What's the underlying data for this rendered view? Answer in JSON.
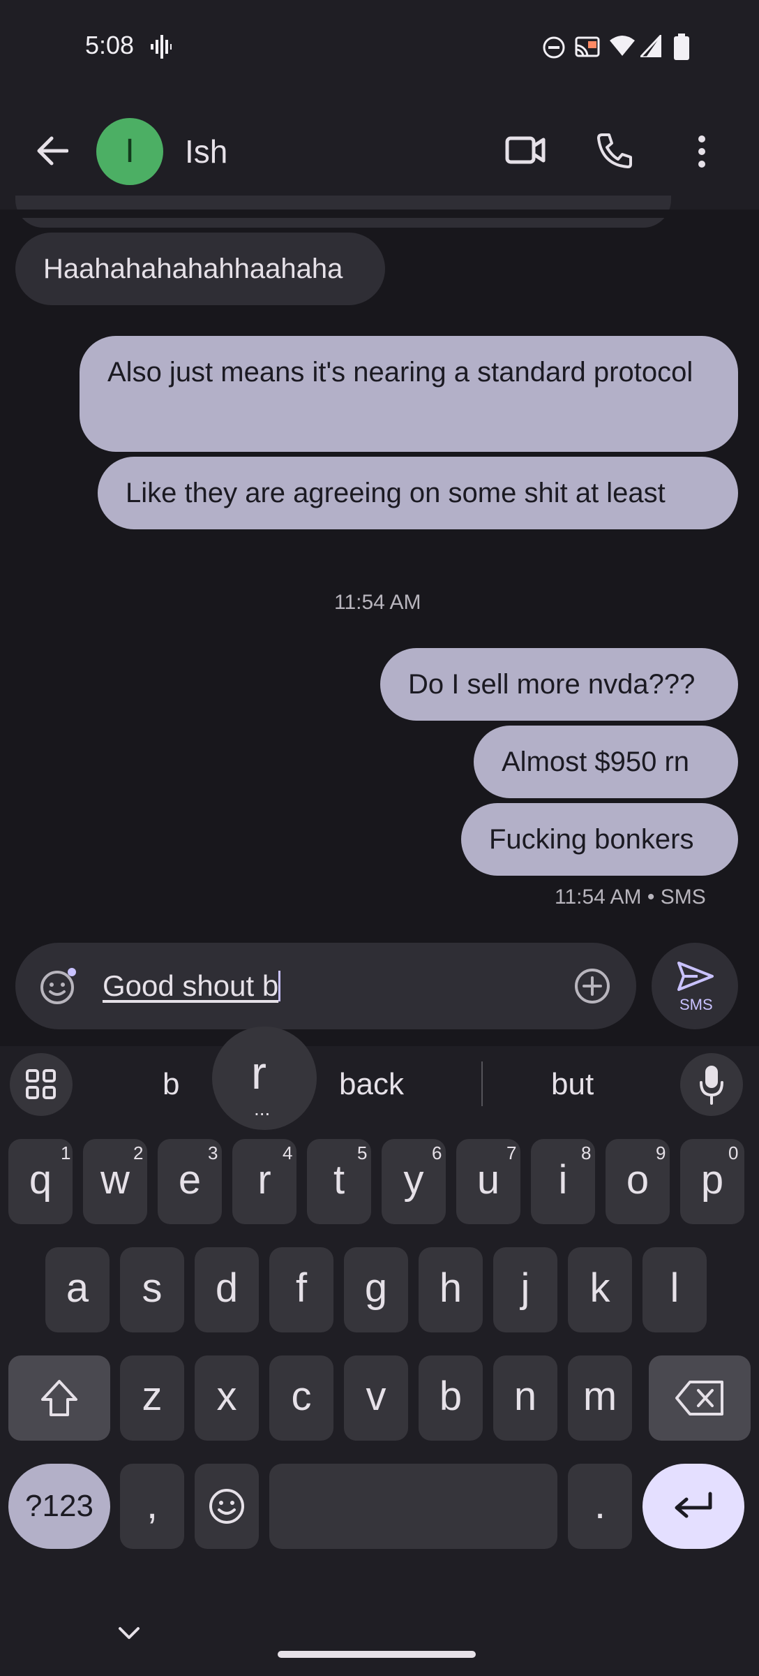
{
  "status_bar": {
    "time": "5:08"
  },
  "header": {
    "avatar_initial": "I",
    "contact_name": "Ish"
  },
  "messages": {
    "m1": "Haahahahahahhaahaha",
    "m2": "Also just means it's nearing a standard protocol",
    "m3": "Like they are agreeing on some shit at least",
    "timestamp1": "11:54 AM",
    "m4": "Do I sell more nvda???",
    "m5": "Almost $950 rn",
    "m6": "Fucking bonkers",
    "meta": "11:54 AM • SMS"
  },
  "compose": {
    "text": "Good shout b",
    "send_label": "SMS"
  },
  "keyboard": {
    "suggestions": [
      "b",
      "back",
      "but"
    ],
    "popup_letter": "r",
    "popup_dots": "...",
    "row1": [
      "q",
      "w",
      "e",
      "r",
      "t",
      "y",
      "u",
      "i",
      "o",
      "p"
    ],
    "row1_hints": [
      "1",
      "2",
      "3",
      "4",
      "5",
      "6",
      "7",
      "8",
      "9",
      "0"
    ],
    "row2": [
      "a",
      "s",
      "d",
      "f",
      "g",
      "h",
      "j",
      "k",
      "l"
    ],
    "row3": [
      "z",
      "x",
      "c",
      "v",
      "b",
      "n",
      "m"
    ],
    "symbols_label": "?123",
    "comma": ",",
    "period": "."
  }
}
